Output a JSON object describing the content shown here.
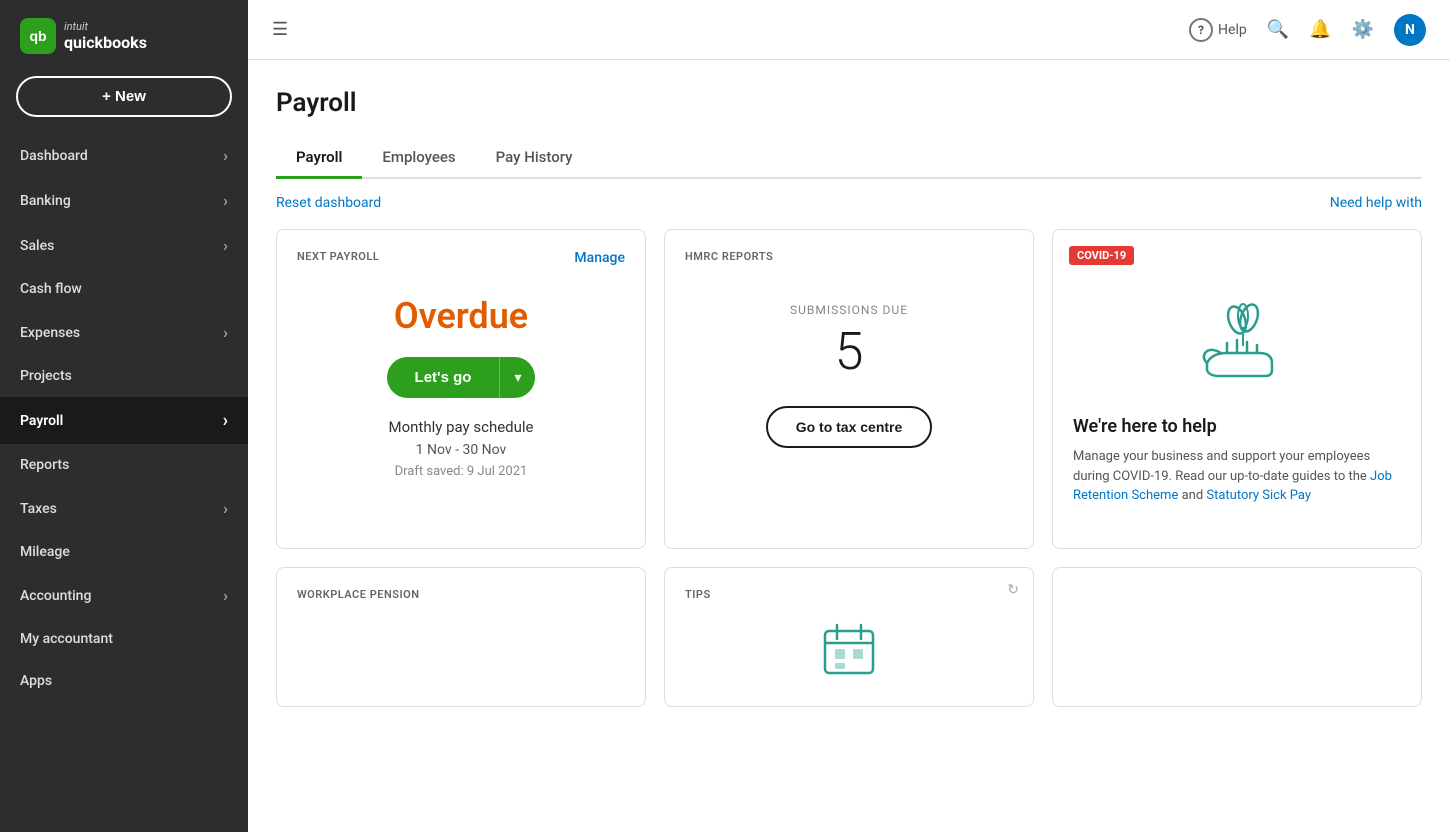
{
  "sidebar": {
    "logo": {
      "text": "intuit",
      "brand": "quickbooks"
    },
    "new_button": "+ New",
    "items": [
      {
        "id": "dashboard",
        "label": "Dashboard",
        "hasChevron": true,
        "active": false
      },
      {
        "id": "banking",
        "label": "Banking",
        "hasChevron": true,
        "active": false
      },
      {
        "id": "sales",
        "label": "Sales",
        "hasChevron": true,
        "active": false
      },
      {
        "id": "cashflow",
        "label": "Cash flow",
        "hasChevron": false,
        "active": false
      },
      {
        "id": "expenses",
        "label": "Expenses",
        "hasChevron": true,
        "active": false
      },
      {
        "id": "projects",
        "label": "Projects",
        "hasChevron": false,
        "active": false
      },
      {
        "id": "payroll",
        "label": "Payroll",
        "hasChevron": false,
        "active": true
      },
      {
        "id": "reports",
        "label": "Reports",
        "hasChevron": false,
        "active": false
      },
      {
        "id": "taxes",
        "label": "Taxes",
        "hasChevron": true,
        "active": false
      },
      {
        "id": "mileage",
        "label": "Mileage",
        "hasChevron": false,
        "active": false
      },
      {
        "id": "accounting",
        "label": "Accounting",
        "hasChevron": true,
        "active": false
      },
      {
        "id": "my-accountant",
        "label": "My accountant",
        "hasChevron": false,
        "active": false
      },
      {
        "id": "apps",
        "label": "Apps",
        "hasChevron": false,
        "active": false
      }
    ]
  },
  "header": {
    "help_label": "Help",
    "user_initial": "N"
  },
  "page": {
    "title": "Payroll",
    "tabs": [
      {
        "id": "payroll",
        "label": "Payroll",
        "active": true
      },
      {
        "id": "employees",
        "label": "Employees",
        "active": false
      },
      {
        "id": "pay-history",
        "label": "Pay History",
        "active": false
      }
    ],
    "reset_dashboard": "Reset dashboard",
    "need_help": "Need help with"
  },
  "cards": {
    "next_payroll": {
      "label": "NEXT PAYROLL",
      "manage_link": "Manage",
      "overdue_text": "Overdue",
      "letsgo_btn": "Let's go",
      "schedule_label": "Monthly pay schedule",
      "date_range": "1 Nov - 30 Nov",
      "draft_saved": "Draft saved: 9 Jul 2021"
    },
    "hmrc_reports": {
      "label": "HMRC REPORTS",
      "submissions_label": "SUBMISSIONS DUE",
      "count": "5",
      "go_tax_btn": "Go to tax centre"
    },
    "covid": {
      "badge": "COVID-19",
      "title": "We're here to help",
      "body": "Manage your business and support your employees during COVID-19. Read our up-to-date guides to the",
      "link1": "Job Retention Scheme",
      "and_text": " and ",
      "link2": "Statutory Sick Pay"
    },
    "workplace_pension": {
      "label": "WORKPLACE PENSION"
    },
    "tips": {
      "label": "TIPS"
    }
  }
}
